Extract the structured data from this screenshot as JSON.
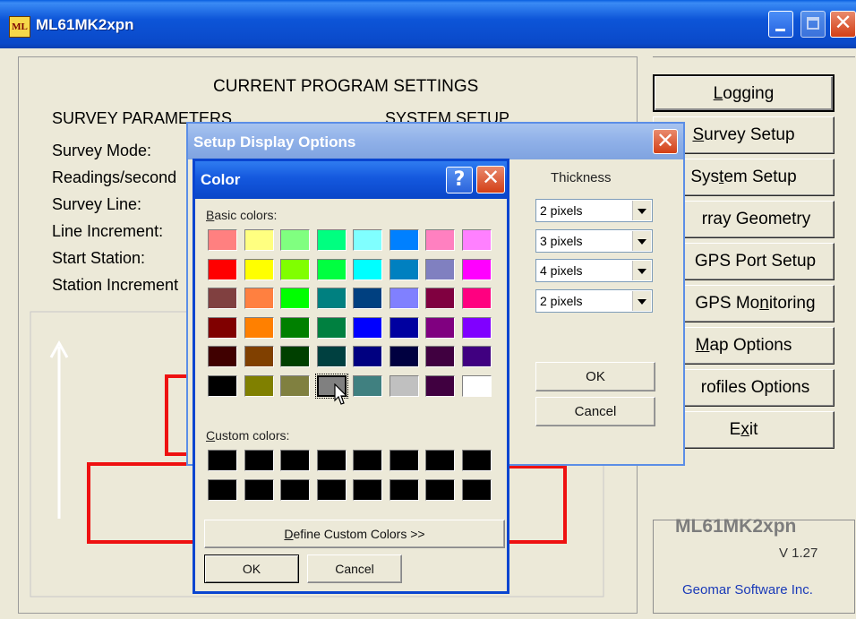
{
  "window": {
    "title": "ML61MK2xpn",
    "app_icon": "ML"
  },
  "main": {
    "heading": "CURRENT PROGRAM SETTINGS",
    "survey_params": "SURVEY PARAMETERS",
    "system_setup": "SYSTEM SETUP",
    "fields": [
      "Survey Mode:",
      "Readings/second",
      "Survey Line:",
      "Line Increment:",
      "Start Station:",
      "Station Increment"
    ]
  },
  "sidebar": {
    "buttons": [
      {
        "pre": "",
        "u": "L",
        "post": "ogging"
      },
      {
        "pre": "",
        "u": "S",
        "post": "urvey Setup"
      },
      {
        "pre": "Sys",
        "u": "t",
        "post": "em Setup"
      },
      {
        "pre": "",
        "u": "",
        "post": "rray Geometry"
      },
      {
        "pre": "",
        "u": "",
        "post": "GPS Port Setup"
      },
      {
        "pre": "GPS Mo",
        "u": "n",
        "post": "itoring"
      },
      {
        "pre": "",
        "u": "M",
        "post": "ap Options"
      },
      {
        "pre": "",
        "u": "",
        "post": "rofiles Options"
      },
      {
        "pre": "E",
        "u": "x",
        "post": "it"
      }
    ],
    "brand": "ML61MK2xpn",
    "version": "V 1.27",
    "company": "Geomar Software Inc."
  },
  "setup_dialog": {
    "title": "Setup Display Options",
    "thickness_label": "Thickness",
    "thickness_values": [
      "2 pixels",
      "3 pixels",
      "4 pixels",
      "2 pixels"
    ],
    "ok": "OK",
    "cancel": "Cancel"
  },
  "color_dialog": {
    "title": "Color",
    "help": "?",
    "basic_label_u": "B",
    "basic_label_rest": "asic colors:",
    "custom_label_u": "C",
    "custom_label_rest": "ustom colors:",
    "basic_colors": [
      "#ff8080",
      "#ffff80",
      "#80ff80",
      "#00ff80",
      "#80ffff",
      "#0080ff",
      "#ff80c0",
      "#ff80ff",
      "#ff0000",
      "#ffff00",
      "#80ff00",
      "#00ff40",
      "#00ffff",
      "#0080c0",
      "#8080c0",
      "#ff00ff",
      "#804040",
      "#ff8040",
      "#00ff00",
      "#008080",
      "#004080",
      "#8080ff",
      "#800040",
      "#ff0080",
      "#800000",
      "#ff8000",
      "#008000",
      "#008040",
      "#0000ff",
      "#0000a0",
      "#800080",
      "#8000ff",
      "#400000",
      "#804000",
      "#004000",
      "#004040",
      "#000080",
      "#000040",
      "#400040",
      "#400080",
      "#000000",
      "#808000",
      "#808040",
      "#808080",
      "#408080",
      "#c0c0c0",
      "#400040",
      "#ffffff"
    ],
    "selected_index": 43,
    "custom_colors": [
      "#000000",
      "#000000",
      "#000000",
      "#000000",
      "#000000",
      "#000000",
      "#000000",
      "#000000",
      "#000000",
      "#000000",
      "#000000",
      "#000000",
      "#000000",
      "#000000",
      "#000000",
      "#000000"
    ],
    "define_u": "D",
    "define_rest": "efine Custom Colors >>",
    "ok": "OK",
    "cancel": "Cancel"
  },
  "colors": {
    "title_blue": "#0a49c9",
    "line_red": "#ee1111",
    "arrow_white": "#ffffff"
  }
}
